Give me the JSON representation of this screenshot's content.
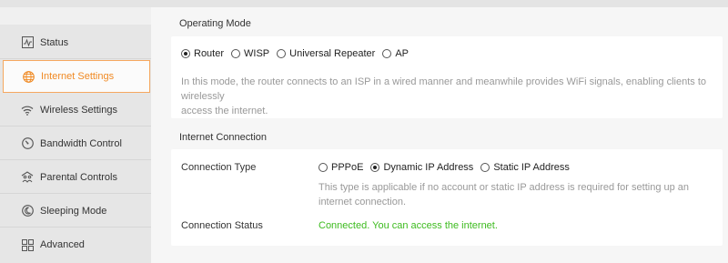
{
  "sidebar": {
    "items": [
      {
        "label": "Status",
        "icon": "status-icon",
        "active": false
      },
      {
        "label": "Internet Settings",
        "icon": "globe-icon",
        "active": true
      },
      {
        "label": "Wireless Settings",
        "icon": "wifi-icon",
        "active": false
      },
      {
        "label": "Bandwidth Control",
        "icon": "gauge-icon",
        "active": false
      },
      {
        "label": "Parental Controls",
        "icon": "family-icon",
        "active": false
      },
      {
        "label": "Sleeping Mode",
        "icon": "moon-icon",
        "active": false
      },
      {
        "label": "Advanced",
        "icon": "grid-icon",
        "active": false
      }
    ]
  },
  "operating_mode": {
    "title": "Operating Mode",
    "options": [
      {
        "label": "Router",
        "checked": true
      },
      {
        "label": "WISP",
        "checked": false
      },
      {
        "label": "Universal Repeater",
        "checked": false
      },
      {
        "label": "AP",
        "checked": false
      }
    ],
    "description_line1": "In this mode, the router connects to an ISP in a wired manner and meanwhile provides WiFi signals, enabling clients to wirelessly",
    "description_line2": "access the internet."
  },
  "internet_connection": {
    "title": "Internet Connection",
    "connection_type_label": "Connection Type",
    "options": [
      {
        "label": "PPPoE",
        "checked": false
      },
      {
        "label": "Dynamic IP Address",
        "checked": true
      },
      {
        "label": "Static IP Address",
        "checked": false
      }
    ],
    "description_line1": "This type is applicable if no account or static IP address is required for setting up an",
    "description_line2": "internet connection.",
    "connection_status_label": "Connection Status",
    "connection_status_value": "Connected. You can access the internet."
  },
  "colors": {
    "accent": "#f08a24",
    "status_ok": "#3dbb1f"
  }
}
